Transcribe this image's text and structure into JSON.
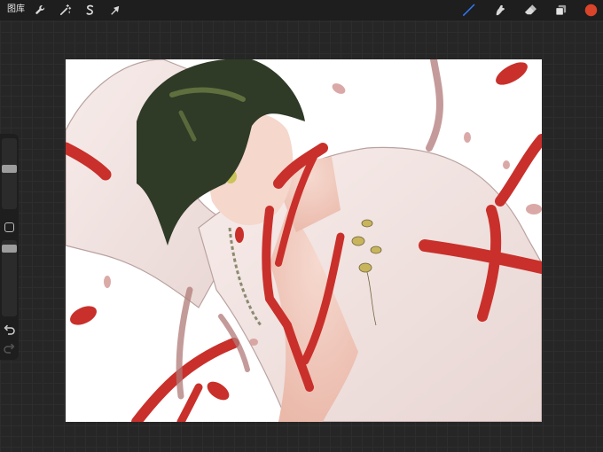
{
  "toolbar": {
    "gallery_label": "图库",
    "left_tools": [
      {
        "name": "wrench-icon",
        "label": "actions"
      },
      {
        "name": "magic-wand-icon",
        "label": "adjustments"
      },
      {
        "name": "selection-s-icon",
        "label": "selection"
      },
      {
        "name": "arrow-cursor-icon",
        "label": "transform"
      }
    ],
    "right_tools": [
      {
        "name": "brush-icon",
        "active": true
      },
      {
        "name": "smudge-icon"
      },
      {
        "name": "eraser-icon"
      },
      {
        "name": "layers-icon"
      },
      {
        "name": "color-swatch-icon"
      }
    ],
    "active_tool_color": "#2f7bff",
    "current_color": "#d9442a"
  },
  "sidebar": {
    "brush_size": 0.38,
    "opacity": 0.9
  },
  "canvas": {
    "artwork": "illustration"
  }
}
